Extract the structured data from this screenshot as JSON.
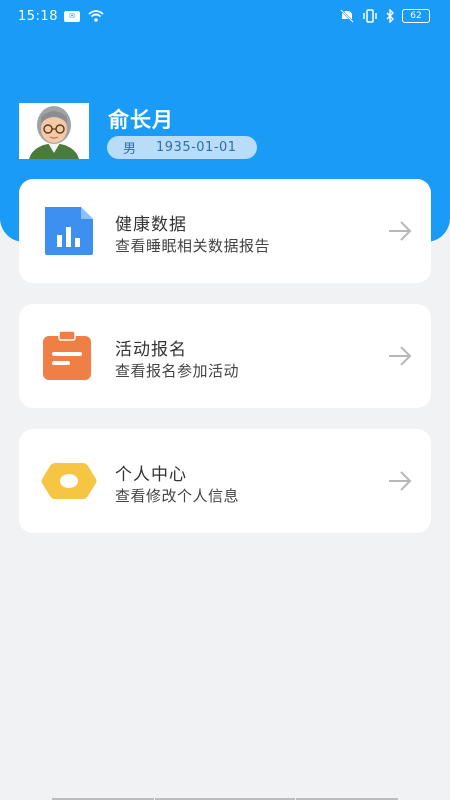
{
  "status_bar": {
    "time": "15:18",
    "left_icons": [
      "notification-badge-icon",
      "wifi-icon"
    ],
    "right_icons": [
      "mute-icon",
      "vibrate-icon",
      "bluetooth-icon"
    ],
    "battery": "62"
  },
  "user": {
    "name": "俞长月",
    "gender": "男",
    "dob": "1935-01-01"
  },
  "menu": [
    {
      "title": "健康数据",
      "subtitle": "查看睡眠相关数据报告",
      "icon": "chart-icon"
    },
    {
      "title": "活动报名",
      "subtitle": "查看报名参加活动",
      "icon": "clipboard-icon"
    },
    {
      "title": "个人中心",
      "subtitle": "查看修改个人信息",
      "icon": "hexagon-icon"
    }
  ],
  "colors": {
    "primary": "#1a9bf6",
    "background": "#f1f2f4",
    "card": "#ffffff",
    "health_icon": "#3d8ff0",
    "activity_icon": "#f07f45",
    "profile_icon": "#f6c543"
  }
}
